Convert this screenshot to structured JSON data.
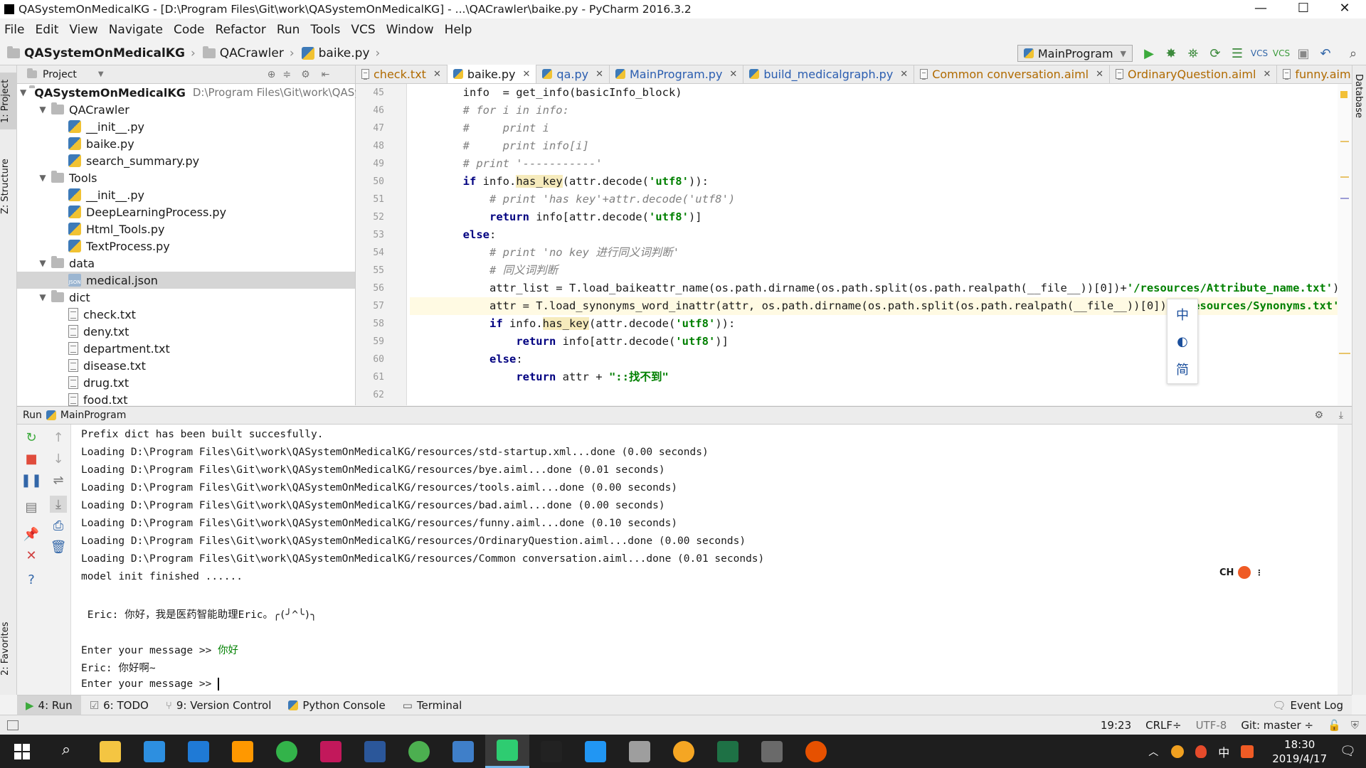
{
  "window": {
    "title": "QASystemOnMedicalKG - [D:\\Program Files\\Git\\work\\QASystemOnMedicalKG] - ...\\QACrawler\\baike.py - PyCharm 2016.3.2"
  },
  "menu": [
    "File",
    "Edit",
    "View",
    "Navigate",
    "Code",
    "Refactor",
    "Run",
    "Tools",
    "VCS",
    "Window",
    "Help"
  ],
  "breadcrumb": [
    "QASystemOnMedicalKG",
    "QACrawler",
    "baike.py"
  ],
  "run_config": "MainProgram",
  "project_panel": {
    "title": "Project",
    "root_label": "QASystemOnMedicalKG",
    "root_path": "D:\\Program Files\\Git\\work\\QASystemOnMedicalKG",
    "nodes": [
      {
        "label": "QACrawler",
        "type": "folder",
        "depth": 1,
        "open": true
      },
      {
        "label": "__init__.py",
        "type": "py",
        "depth": 2
      },
      {
        "label": "baike.py",
        "type": "py",
        "depth": 2
      },
      {
        "label": "search_summary.py",
        "type": "py",
        "depth": 2
      },
      {
        "label": "Tools",
        "type": "folder",
        "depth": 1,
        "open": true
      },
      {
        "label": "__init__.py",
        "type": "py",
        "depth": 2
      },
      {
        "label": "DeepLearningProcess.py",
        "type": "py",
        "depth": 2
      },
      {
        "label": "Html_Tools.py",
        "type": "py",
        "depth": 2
      },
      {
        "label": "TextProcess.py",
        "type": "py",
        "depth": 2
      },
      {
        "label": "data",
        "type": "folder",
        "depth": 1,
        "open": true
      },
      {
        "label": "medical.json",
        "type": "json",
        "depth": 2,
        "selected": true
      },
      {
        "label": "dict",
        "type": "folder",
        "depth": 1,
        "open": true
      },
      {
        "label": "check.txt",
        "type": "txt",
        "depth": 2
      },
      {
        "label": "deny.txt",
        "type": "txt",
        "depth": 2
      },
      {
        "label": "department.txt",
        "type": "txt",
        "depth": 2
      },
      {
        "label": "disease.txt",
        "type": "txt",
        "depth": 2
      },
      {
        "label": "drug.txt",
        "type": "txt",
        "depth": 2
      },
      {
        "label": "food.txt",
        "type": "txt",
        "depth": 2
      }
    ]
  },
  "editor_tabs": [
    {
      "label": "check.txt",
      "icon": "txt"
    },
    {
      "label": "baike.py",
      "icon": "py",
      "active": true
    },
    {
      "label": "qa.py",
      "icon": "py"
    },
    {
      "label": "MainProgram.py",
      "icon": "py"
    },
    {
      "label": "build_medicalgraph.py",
      "icon": "py"
    },
    {
      "label": "Common conversation.aiml",
      "icon": "txt"
    },
    {
      "label": "OrdinaryQuestion.aiml",
      "icon": "txt"
    },
    {
      "label": "funny.aiml",
      "icon": "txt"
    }
  ],
  "code_lines": [
    {
      "n": "45",
      "html": "        info  = get_info(basicInfo_block)"
    },
    {
      "n": "46",
      "html": "        <span class='cm'># for i in info:</span>"
    },
    {
      "n": "47",
      "html": "        <span class='cm'>#     print i</span>"
    },
    {
      "n": "48",
      "html": "        <span class='cm'>#     print info[i]</span>"
    },
    {
      "n": "49",
      "html": "        <span class='cm'># print '-----------'</span>"
    },
    {
      "n": "50",
      "html": "        <span class='kw'>if</span> info.<span class='hl'>has_key</span>(attr.decode(<span class='str'>'utf8'</span>)):"
    },
    {
      "n": "51",
      "html": "            <span class='cm'># print 'has key'+attr.decode('utf8')</span>"
    },
    {
      "n": "52",
      "html": "            <span class='kw'>return</span> info[attr.decode(<span class='str'>'utf8'</span>)]"
    },
    {
      "n": "53",
      "html": "        <span class='kw'>else</span>:"
    },
    {
      "n": "54",
      "html": "            <span class='cm'># print 'no key 进行同义词判断'</span>"
    },
    {
      "n": "55",
      "html": "            <span class='cm'># 同义词判断</span>"
    },
    {
      "n": "56",
      "html": "            attr_list = T.load_baikeattr_name(os.path.dirname(os.path.split(os.path.realpath(__file__))[0])+<span class='str'>'/resources/Attribute_name.txt'</span>)"
    },
    {
      "n": "57",
      "html": "            attr = T.load_synonyms_word_inattr(attr, os.path.dirname(os.path.split(os.path.realpath(__file__))[0])+<span class='str'>'/resources/Synonyms.txt'</span>, attr_list)",
      "cur": true
    },
    {
      "n": "58",
      "html": "            <span class='kw'>if</span> info.<span class='hl'>has_key</span>(attr.decode(<span class='str'>'utf8'</span>)):"
    },
    {
      "n": "59",
      "html": "                <span class='kw'>return</span> info[attr.decode(<span class='str'>'utf8'</span>)]"
    },
    {
      "n": "60",
      "html": "            <span class='kw'>else</span>:"
    },
    {
      "n": "61",
      "html": "                <span class='kw'>return</span> attr + <span class='str'>\"::找不到\"</span>"
    },
    {
      "n": "62",
      "html": ""
    }
  ],
  "ime_popup": [
    "中",
    "◐",
    "简"
  ],
  "run_panel": {
    "label": "Run",
    "config": "MainProgram"
  },
  "console_lines": [
    {
      "text": "Prefix dict has been built succesfully."
    },
    {
      "text": "Loading D:\\Program Files\\Git\\work\\QASystemOnMedicalKG/resources/std-startup.xml...done (0.00 seconds)"
    },
    {
      "text": "Loading D:\\Program Files\\Git\\work\\QASystemOnMedicalKG/resources/bye.aiml...done (0.01 seconds)"
    },
    {
      "text": "Loading D:\\Program Files\\Git\\work\\QASystemOnMedicalKG/resources/tools.aiml...done (0.00 seconds)"
    },
    {
      "text": "Loading D:\\Program Files\\Git\\work\\QASystemOnMedicalKG/resources/bad.aiml...done (0.00 seconds)"
    },
    {
      "text": "Loading D:\\Program Files\\Git\\work\\QASystemOnMedicalKG/resources/funny.aiml...done (0.10 seconds)"
    },
    {
      "text": "Loading D:\\Program Files\\Git\\work\\QASystemOnMedicalKG/resources/OrdinaryQuestion.aiml...done (0.00 seconds)"
    },
    {
      "text": "Loading D:\\Program Files\\Git\\work\\QASystemOnMedicalKG/resources/Common conversation.aiml...done (0.01 seconds)"
    },
    {
      "text": "model init finished ......"
    },
    {
      "text": ""
    },
    {
      "text": " Eric: 你好，我是医药智能助理Eric。╭(╯^╰)╮"
    },
    {
      "text": ""
    },
    {
      "text": "Enter your message >> ",
      "input": "你好"
    },
    {
      "text": "Eric: 你好啊~"
    },
    {
      "text": "Enter your message >> ",
      "cursor": true
    }
  ],
  "ch_badge": "CH",
  "bottom_tabs": [
    {
      "label": "4: Run",
      "active": true
    },
    {
      "label": "6: TODO"
    },
    {
      "label": "9: Version Control"
    },
    {
      "label": "Python Console"
    },
    {
      "label": "Terminal"
    }
  ],
  "event_log": "Event Log",
  "left_tool_tabs": [
    "1: Project",
    "Z: Structure",
    "2: Favorites"
  ],
  "right_tool_tabs": [
    "Database"
  ],
  "status": {
    "position": "19:23",
    "line_sep": "CRLF÷",
    "encoding": "UTF-8",
    "git": "Git: master ÷"
  },
  "taskbar": {
    "apps": [
      {
        "name": "windows-start",
        "color": "#ffffff"
      },
      {
        "name": "search",
        "color": "#ffffff"
      },
      {
        "name": "file-explorer",
        "color": "#f4c542"
      },
      {
        "name": "internet-explorer",
        "color": "#2d8fe0"
      },
      {
        "name": "edge",
        "color": "#1f7ad6"
      },
      {
        "name": "sublime",
        "color": "#ff9800"
      },
      {
        "name": "360-browser",
        "color": "#33b34a"
      },
      {
        "name": "intellij",
        "color": "#c2185b"
      },
      {
        "name": "word",
        "color": "#2b579a"
      },
      {
        "name": "wechat",
        "color": "#4caf50"
      },
      {
        "name": "window-app",
        "color": "#3f7fc9"
      },
      {
        "name": "pycharm",
        "color": "#2ecc71",
        "active": true
      },
      {
        "name": "terminal",
        "color": "#222222"
      },
      {
        "name": "stock-app",
        "color": "#2196f3"
      },
      {
        "name": "search-app",
        "color": "#9e9e9e"
      },
      {
        "name": "notes-app",
        "color": "#f5a623"
      },
      {
        "name": "excel",
        "color": "#1e7145"
      },
      {
        "name": "git-app",
        "color": "#6a6a6a"
      },
      {
        "name": "pet-app",
        "color": "#e65100"
      }
    ],
    "time": "18:30",
    "date": "2019/4/17",
    "ime": "中"
  }
}
